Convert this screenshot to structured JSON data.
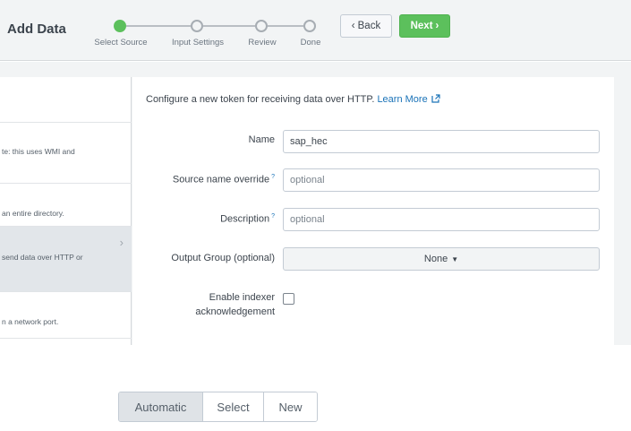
{
  "header": {
    "title": "Add Data",
    "steps": [
      {
        "label": "Select Source",
        "active": true
      },
      {
        "label": "Input Settings",
        "active": false
      },
      {
        "label": "Review",
        "active": false
      },
      {
        "label": "Done",
        "active": false
      }
    ],
    "back_label": "Back",
    "next_label": "Next"
  },
  "sources": [
    {
      "text": "te: this uses WMI and",
      "selected": false
    },
    {
      "text": "an entire directory.",
      "selected": false
    },
    {
      "text": "send data over HTTP or",
      "selected": true
    },
    {
      "text": "n a network port.",
      "selected": false
    }
  ],
  "form": {
    "intro_text": "Configure a new token for receiving data over HTTP.",
    "learn_more": "Learn More",
    "name_label": "Name",
    "name_value": "sap_hec",
    "source_name_label": "Source name override",
    "source_name_placeholder": "optional",
    "description_label": "Description",
    "description_placeholder": "optional",
    "help_mark": "?",
    "output_group_label": "Output Group (optional)",
    "output_group_value": "None",
    "indexer_label_line1": "Enable indexer",
    "indexer_label_line2": "acknowledgement",
    "indexer_checked": false
  },
  "segmented": {
    "options": [
      "Automatic",
      "Select",
      "New"
    ],
    "selected": "Automatic"
  },
  "colors": {
    "accent_green": "#5cc05c",
    "link_blue": "#1a73b8"
  }
}
